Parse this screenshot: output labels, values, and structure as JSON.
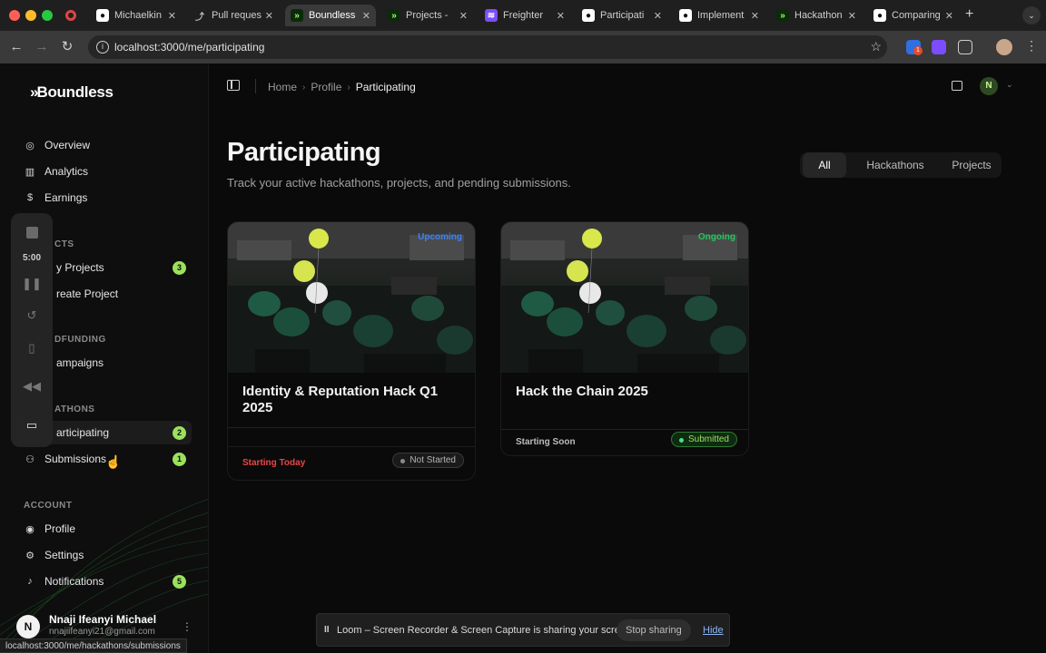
{
  "browser": {
    "tabs": [
      {
        "label": "Michaelkin",
        "favicon": "github-icon"
      },
      {
        "label": "Pull reques",
        "favicon": "git-pull-request-icon"
      },
      {
        "label": "Boundless",
        "favicon": "boundless-icon",
        "active": true
      },
      {
        "label": "Projects -",
        "favicon": "boundless-icon"
      },
      {
        "label": "Freighter",
        "favicon": "freighter-icon"
      },
      {
        "label": "Participati",
        "favicon": "github-icon"
      },
      {
        "label": "Implement",
        "favicon": "github-icon"
      },
      {
        "label": "Hackathon",
        "favicon": "boundless-icon"
      },
      {
        "label": "Comparing",
        "favicon": "github-icon"
      }
    ],
    "new_tab": "+",
    "address": "localhost:3000/me/participating",
    "status_url": "localhost:3000/me/hackathons/submissions"
  },
  "sidebar": {
    "logo_text": "Boundless",
    "primary": [
      {
        "label": "Overview",
        "icon": "overview-icon"
      },
      {
        "label": "Analytics",
        "icon": "analytics-icon"
      },
      {
        "label": "Earnings",
        "icon": "dollar-icon"
      }
    ],
    "sections": {
      "projects": "CTS",
      "crowdfunding": "DFUNDING",
      "hackathons": "ATHONS",
      "account": "ACCOUNT"
    },
    "projects_items": [
      {
        "label": "y Projects",
        "badge": "3"
      },
      {
        "label": "reate Project",
        "badge": ""
      }
    ],
    "crowdfunding_items": [
      {
        "label": "ampaigns"
      }
    ],
    "hackathon_items": [
      {
        "label": "articipating",
        "badge": "2",
        "active": true
      },
      {
        "label": "Submissions",
        "badge": "1"
      }
    ],
    "account_items": [
      {
        "label": "Profile",
        "icon": "user-icon"
      },
      {
        "label": "Settings",
        "icon": "gear-icon"
      },
      {
        "label": "Notifications",
        "icon": "bell-icon",
        "badge": "5"
      }
    ],
    "user": {
      "initial": "N",
      "name": "Nnaji Ifeanyi Michael",
      "email": "nnajiifeanyi21@gmail.com"
    }
  },
  "loom_panel": {
    "timer": "5:00"
  },
  "header": {
    "breadcrumb": [
      "Home",
      "Profile",
      "Participating"
    ],
    "account_initial": "N"
  },
  "page": {
    "title": "Participating",
    "subtitle": "Track your active hackathons, projects, and pending submissions.",
    "filters": [
      {
        "label": "All",
        "active": true
      },
      {
        "label": "Hackathons"
      },
      {
        "label": "Projects"
      }
    ]
  },
  "cards": [
    {
      "status": "Upcoming",
      "status_color": "#3b82f6",
      "title": "Identity & Reputation Hack Q1 2025",
      "when": "Starting Today",
      "when_color": "#ef4444",
      "pill": "Not Started",
      "pill_style": "grey"
    },
    {
      "status": "Ongoing",
      "status_color": "#22c55e",
      "title": "Hack the Chain 2025",
      "when": "Starting Soon",
      "when_color": "#bdbdbd",
      "pill": "Submitted",
      "pill_style": "green"
    }
  ],
  "sharebar": {
    "pause": "II",
    "message": "Loom – Screen Recorder & Screen Capture is sharing your screen.",
    "stop_label": "Stop sharing",
    "hide_label": "Hide"
  },
  "colors": {
    "accent": "#9be15d",
    "background": "#0a0a0a"
  }
}
